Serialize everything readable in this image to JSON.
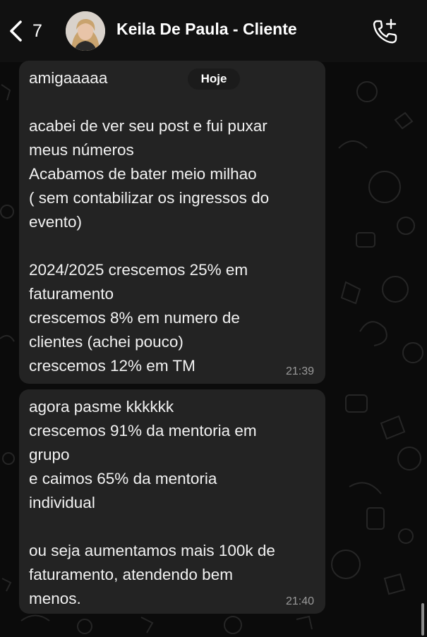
{
  "header": {
    "back_count": "7",
    "contact_name": "Keila De Paula - Cliente",
    "back_icon": "chevron-left-icon",
    "call_icon": "phone-plus-icon"
  },
  "date_divider": "Hoje",
  "messages": [
    {
      "lines": [
        "amigaaaaa",
        "",
        "acabei de ver seu post e fui puxar",
        "meus números",
        "Acabamos de bater meio milhao",
        "( sem contabilizar os ingressos do",
        "evento)",
        "",
        "2024/2025 crescemos 25% em",
        "faturamento",
        "crescemos 8% em numero de",
        "clientes (achei pouco)",
        "crescemos 12% em TM"
      ],
      "time": "21:39"
    },
    {
      "lines": [
        "agora pasme kkkkkk",
        "crescemos 91% da mentoria em",
        "grupo",
        "e caimos 65% da mentoria",
        "individual",
        "",
        "ou seja aumentamos mais 100k de",
        "faturamento, atendendo bem",
        "menos."
      ],
      "time": "21:40"
    }
  ],
  "colors": {
    "background": "#0b0b0b",
    "header": "#111111",
    "bubble": "#232323",
    "timestamp": "#9a9a9a"
  }
}
